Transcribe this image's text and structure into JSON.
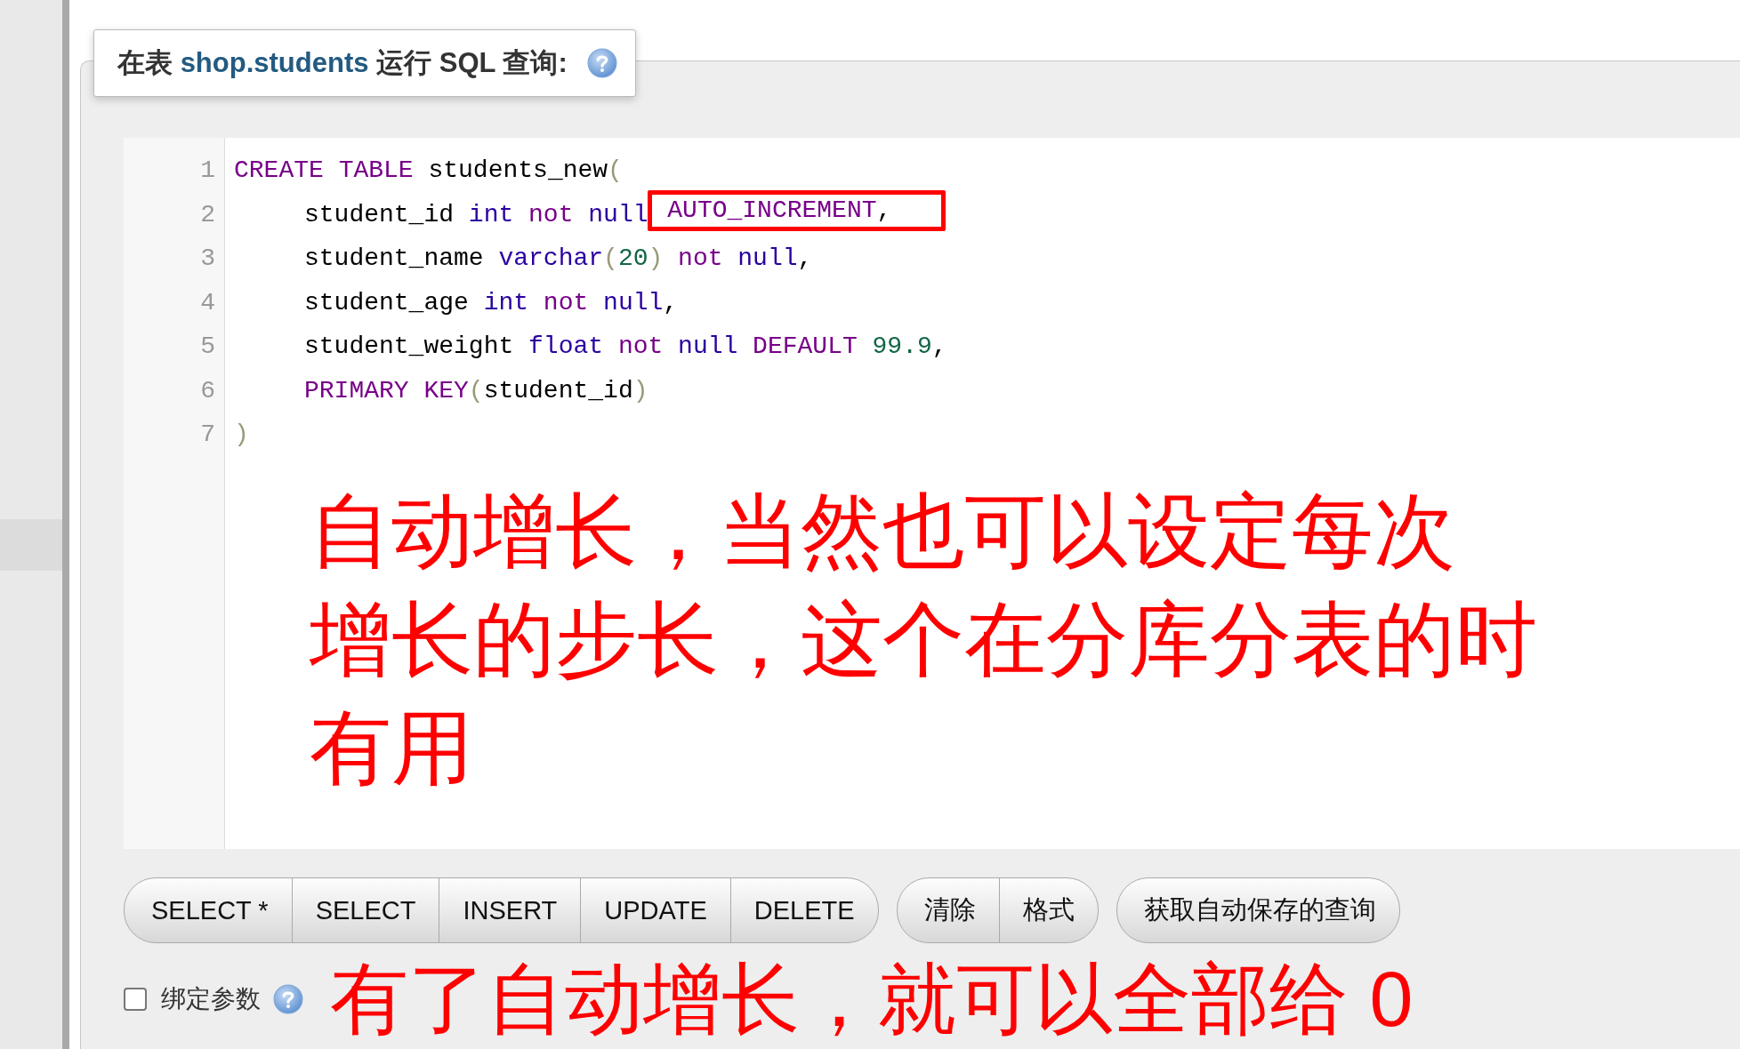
{
  "query_box": {
    "title_prefix": "在表",
    "table_name": "shop.students",
    "title_suffix": "运行 SQL 查询:"
  },
  "editor": {
    "lines": [
      {
        "number": "1",
        "indented": false,
        "tokens": [
          {
            "text": "CREATE",
            "kind": "keyword"
          },
          {
            "text": " TABLE",
            "kind": "keyword"
          },
          {
            "text": " students_new",
            "kind": "plain"
          },
          {
            "text": "(",
            "kind": "bracket"
          }
        ]
      },
      {
        "number": "2",
        "indented": true,
        "tokens": [
          {
            "text": "student_id",
            "kind": "plain"
          },
          {
            "text": " int",
            "kind": "type"
          },
          {
            "text": " not",
            "kind": "keyword"
          },
          {
            "text": " null",
            "kind": "type"
          },
          {
            "text": " AUTO_INCREMENT",
            "kind": "keyword",
            "boxed": true
          },
          {
            "text": ",",
            "kind": "plain"
          }
        ]
      },
      {
        "number": "3",
        "indented": true,
        "tokens": [
          {
            "text": "student_name",
            "kind": "plain"
          },
          {
            "text": " varchar",
            "kind": "type"
          },
          {
            "text": "(",
            "kind": "bracket"
          },
          {
            "text": "20",
            "kind": "number"
          },
          {
            "text": ")",
            "kind": "bracket"
          },
          {
            "text": " not",
            "kind": "keyword"
          },
          {
            "text": " null",
            "kind": "type"
          },
          {
            "text": ",",
            "kind": "plain"
          }
        ]
      },
      {
        "number": "4",
        "indented": true,
        "tokens": [
          {
            "text": "student_age",
            "kind": "plain"
          },
          {
            "text": " int",
            "kind": "type"
          },
          {
            "text": " not",
            "kind": "keyword"
          },
          {
            "text": " null",
            "kind": "type"
          },
          {
            "text": ",",
            "kind": "plain"
          }
        ]
      },
      {
        "number": "5",
        "indented": true,
        "tokens": [
          {
            "text": "student_weight",
            "kind": "plain"
          },
          {
            "text": " float",
            "kind": "type"
          },
          {
            "text": " not",
            "kind": "keyword"
          },
          {
            "text": " null",
            "kind": "type"
          },
          {
            "text": " DEFAULT",
            "kind": "keyword"
          },
          {
            "text": " 99.9",
            "kind": "number"
          },
          {
            "text": ",",
            "kind": "plain"
          }
        ]
      },
      {
        "number": "6",
        "indented": true,
        "tokens": [
          {
            "text": "PRIMARY",
            "kind": "keyword"
          },
          {
            "text": " KEY",
            "kind": "keyword"
          },
          {
            "text": "(",
            "kind": "bracket"
          },
          {
            "text": "student_id",
            "kind": "plain"
          },
          {
            "text": ")",
            "kind": "bracket"
          }
        ]
      },
      {
        "number": "7",
        "indented": false,
        "tokens": [
          {
            "text": ")",
            "kind": "bracket"
          }
        ]
      }
    ],
    "annotation_lines": [
      "自动增长，当然也可以设定每次",
      "增长的步长，这个在分库分表的时",
      "有用"
    ]
  },
  "button_groups": [
    [
      "SELECT *",
      "SELECT",
      "INSERT",
      "UPDATE",
      "DELETE"
    ],
    [
      "清除",
      "格式"
    ],
    [
      "获取自动保存的查询"
    ]
  ],
  "bind_params": {
    "label": "绑定参数",
    "checked": false
  },
  "bottom_annotation": "有了自动增长，就可以全部给 0"
}
